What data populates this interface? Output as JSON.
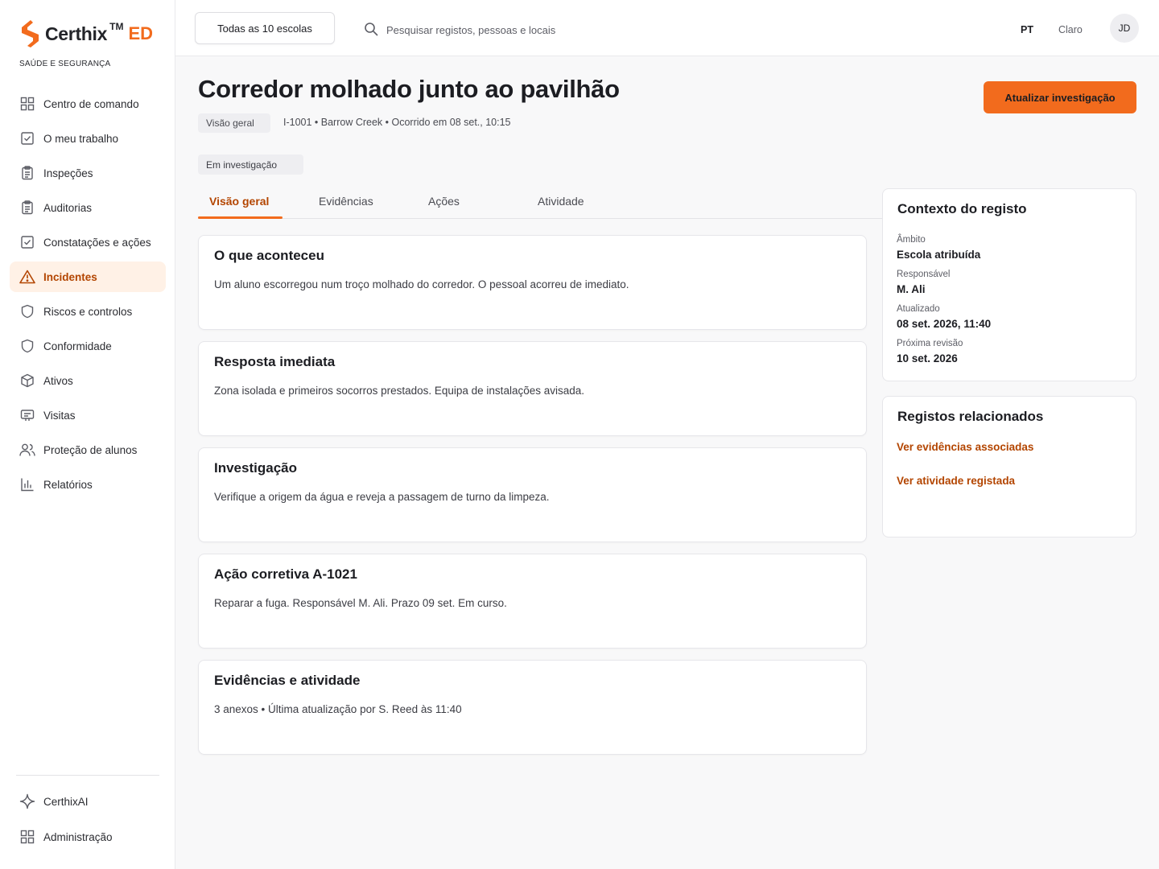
{
  "brand": {
    "name": "Certhix",
    "tm": "TM",
    "edition": "ED",
    "subtitle": "SAÚDE E SEGURANÇA",
    "accent": "#f26b1d"
  },
  "sidebar": {
    "items": [
      {
        "label": "Centro de comando",
        "icon": "grid-icon"
      },
      {
        "label": "O meu trabalho",
        "icon": "checkbox-icon"
      },
      {
        "label": "Inspeções",
        "icon": "clipboard-icon"
      },
      {
        "label": "Auditorias",
        "icon": "clipboard-icon"
      },
      {
        "label": "Constatações e ações",
        "icon": "checkbox-icon"
      },
      {
        "label": "Incidentes",
        "icon": "warning-icon",
        "active": true
      },
      {
        "label": "Riscos e controlos",
        "icon": "shield-icon"
      },
      {
        "label": "Conformidade",
        "icon": "shield-icon"
      },
      {
        "label": "Ativos",
        "icon": "box-icon"
      },
      {
        "label": "Visitas",
        "icon": "badge-icon"
      },
      {
        "label": "Proteção de alunos",
        "icon": "users-icon"
      },
      {
        "label": "Relatórios",
        "icon": "bar-chart-icon"
      }
    ],
    "bottom": [
      {
        "label": "CerthixAI",
        "icon": "sparkle-icon"
      },
      {
        "label": "Administração",
        "icon": "grid-icon"
      }
    ]
  },
  "topbar": {
    "school_selector": "Todas as 10 escolas",
    "search_placeholder": "Pesquisar registos, pessoas e locais",
    "language": "PT",
    "theme": "Claro",
    "avatar_initials": "JD"
  },
  "header": {
    "title": "Corredor molhado junto ao pavilhão",
    "crumb": "Visão geral",
    "meta": "I-1001 • Barrow Creek • Ocorrido em 08 set., 10:15",
    "status": "Em investigação",
    "primary_action": "Atualizar investigação"
  },
  "tabs": [
    {
      "label": "Visão geral",
      "active": true
    },
    {
      "label": "Evidências"
    },
    {
      "label": "Ações"
    },
    {
      "label": "Atividade"
    }
  ],
  "cards": [
    {
      "title": "O que aconteceu",
      "body": "Um aluno escorregou num troço molhado do corredor. O pessoal acorreu de imediato."
    },
    {
      "title": "Resposta imediata",
      "body": "Zona isolada e primeiros socorros prestados. Equipa de instalações avisada."
    },
    {
      "title": "Investigação",
      "body": "Verifique a origem da água e reveja a passagem de turno da limpeza."
    },
    {
      "title": "Ação corretiva A-1021",
      "body": "Reparar a fuga. Responsável M. Ali. Prazo 09 set. Em curso."
    },
    {
      "title": "Evidências e atividade",
      "body": "3 anexos • Última atualização por S. Reed às 11:40"
    }
  ],
  "context": {
    "title": "Contexto do registo",
    "fields": [
      {
        "label": "Âmbito",
        "value": "Escola atribuída"
      },
      {
        "label": "Responsável",
        "value": "M. Ali"
      },
      {
        "label": "Atualizado",
        "value": "08 set. 2026, 11:40"
      },
      {
        "label": "Próxima revisão",
        "value": "10 set. 2026"
      }
    ]
  },
  "related": {
    "title": "Registos relacionados",
    "links": [
      "Ver evidências associadas",
      "Ver atividade registada"
    ]
  }
}
